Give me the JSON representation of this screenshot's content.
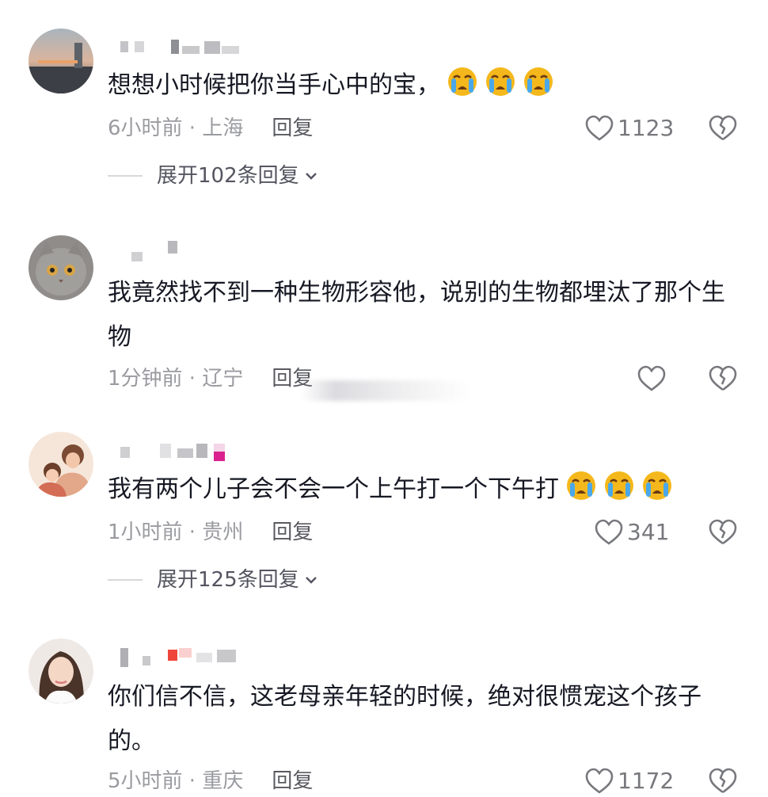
{
  "comments": [
    {
      "text": "想想小时候把你当手心中的宝，",
      "time_location": "6小时前 · 上海",
      "reply_label": "回复",
      "like_count": "1123",
      "expand_label": "展开102条回复",
      "emoji": [
        "crying-face",
        "crying-face",
        "crying-face"
      ]
    },
    {
      "text": "我竟然找不到一种生物形容他，说别的生物都埋汰了那个生物",
      "time_location": "1分钟前 · 辽宁",
      "reply_label": "回复",
      "like_count": ""
    },
    {
      "text": "我有两个儿子会不会一个上午打一个下午打",
      "time_location": "1小时前 · 贵州",
      "reply_label": "回复",
      "like_count": "341",
      "expand_label": "展开125条回复",
      "emoji": [
        "crying-face",
        "crying-face",
        "crying-face"
      ]
    },
    {
      "text": "你们信不信，这老母亲年轻的时候，绝对很惯宠这个孩子的。",
      "time_location": "5小时前 · 重庆",
      "reply_label": "回复",
      "like_count": "1172"
    }
  ],
  "colors": {
    "text": "#161823",
    "meta": "#9a9ba0",
    "reply": "#595a60",
    "emoji_face": "#f5b81c"
  }
}
